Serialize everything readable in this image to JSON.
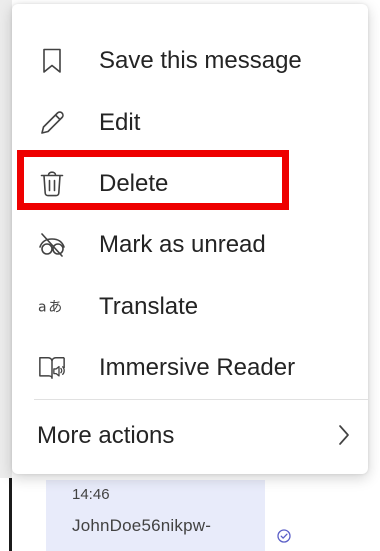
{
  "menu": {
    "items": [
      {
        "label": "Save this message",
        "icon": "bookmark-icon"
      },
      {
        "label": "Edit",
        "icon": "pencil-icon"
      },
      {
        "label": "Delete",
        "icon": "trash-icon"
      },
      {
        "label": "Mark as unread",
        "icon": "mark-unread-icon"
      },
      {
        "label": "Translate",
        "icon": "translate-icon"
      },
      {
        "label": "Immersive Reader",
        "icon": "immersive-reader-icon"
      }
    ],
    "more_actions": {
      "label": "More actions",
      "icon": "chevron-right-icon"
    }
  },
  "message": {
    "time": "14:46",
    "sender": "JohnDoe56nikpw-",
    "status_icon": "read-receipt-icon"
  },
  "colors": {
    "highlight": "#ee0000",
    "bubble": "#e8ebfa",
    "text": "#242424"
  }
}
